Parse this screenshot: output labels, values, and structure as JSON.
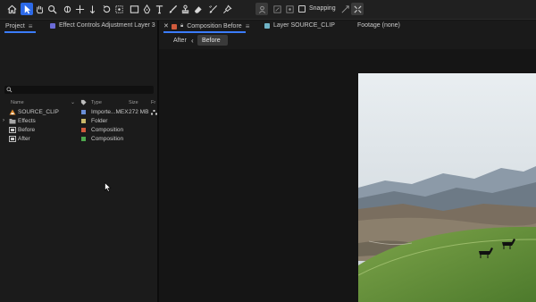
{
  "toolbar": {
    "snapping_label": "Snapping",
    "tools": [
      "home-icon",
      "selection-tool-icon",
      "hand-tool-icon",
      "zoom-tool-icon",
      "orbit-camera-icon",
      "pan-camera-icon",
      "dolly-camera-icon",
      "rotation-tool-icon",
      "anchor-point-icon",
      "rectangle-tool-icon",
      "pen-tool-icon",
      "type-tool-icon",
      "brush-tool-icon",
      "clone-stamp-icon",
      "eraser-icon",
      "roto-brush-icon",
      "puppet-pin-icon"
    ],
    "accent_color": "#2d6ae8"
  },
  "left_panel": {
    "tabs": [
      {
        "label": "Project"
      },
      {
        "label": "Effect Controls Adjustment Layer 3"
      }
    ],
    "search_placeholder": "",
    "columns": {
      "name": "Name",
      "type": "Type",
      "size": "Size",
      "frame_rate": "Fr"
    },
    "items": [
      {
        "name": "SOURCE_CLIP",
        "icon": "footage-icon",
        "label_color": "#6a8fd6",
        "type": "Importe...MEX",
        "size": "272 MB",
        "expandable": false
      },
      {
        "name": "Effects",
        "icon": "folder-icon",
        "label_color": "#c9b86a",
        "type": "Folder",
        "size": "",
        "expandable": true
      },
      {
        "name": "Before",
        "icon": "composition-icon",
        "label_color": "#d05a3c",
        "type": "Composition",
        "size": "",
        "expandable": false
      },
      {
        "name": "After",
        "icon": "composition-icon",
        "label_color": "#4ea84e",
        "type": "Composition",
        "size": "",
        "expandable": false
      }
    ]
  },
  "right_panel": {
    "tabs": [
      {
        "label": "Composition Before",
        "active": true
      },
      {
        "label": "Layer SOURCE_CLIP"
      },
      {
        "label": "Footage (none)"
      }
    ],
    "breadcrumbs": [
      "After",
      "Before"
    ]
  }
}
